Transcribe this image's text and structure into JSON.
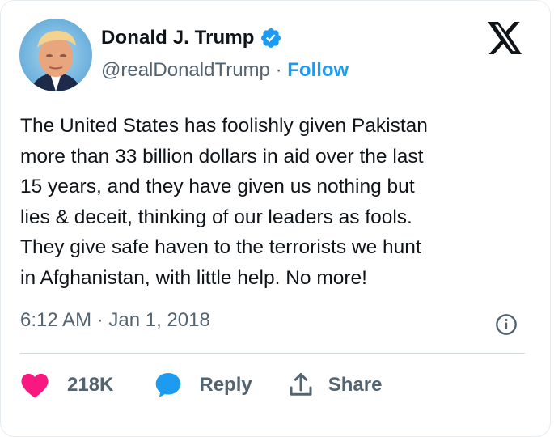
{
  "author": {
    "name": "Donald J. Trump",
    "handle": "@realDonaldTrump",
    "separator": "·",
    "follow_label": "Follow"
  },
  "tweet": {
    "lines": [
      "The United States has foolishly given Pakistan",
      "more than 33 billion dollars in aid over the last",
      "15 years, and they have given us nothing but",
      "lies & deceit, thinking of our leaders as fools.",
      "They give safe haven to the terrorists we hunt",
      "in Afghanistan, with little help. No more!"
    ],
    "timestamp": "6:12 AM · Jan 1, 2018"
  },
  "actions": {
    "like_count": "218K",
    "reply_label": "Reply",
    "share_label": "Share"
  },
  "icons": {
    "verified": "verified-badge-icon",
    "brand": "x-logo-icon",
    "info": "info-icon",
    "like": "heart-icon",
    "reply": "speech-bubble-icon",
    "share": "share-upload-icon"
  },
  "colors": {
    "accent": "#1d9bf0",
    "like": "#f91880",
    "text": "#0f1419",
    "muted": "#536471",
    "divider": "#cfd9de"
  }
}
